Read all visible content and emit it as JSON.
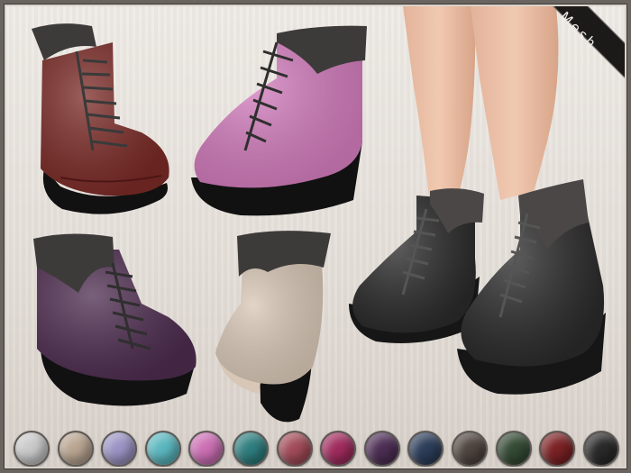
{
  "badge": {
    "label": "Mesh"
  },
  "boots": [
    {
      "name": "red-boot",
      "color": "#7a2a26"
    },
    {
      "name": "pink-boot",
      "color": "#d27cbc"
    },
    {
      "name": "purple-boot",
      "color": "#4d2c4f"
    },
    {
      "name": "beige-boot",
      "color": "#d8c7b6"
    },
    {
      "name": "black-boot",
      "color": "#2b2a2a"
    }
  ],
  "swatches": [
    {
      "name": "silver",
      "color": "#c9c9c9"
    },
    {
      "name": "beige",
      "color": "#b9a591"
    },
    {
      "name": "lavender",
      "color": "#9c94c4"
    },
    {
      "name": "turquoise",
      "color": "#5bb7bf"
    },
    {
      "name": "pink",
      "color": "#cc6fb4"
    },
    {
      "name": "teal",
      "color": "#2f7e7f"
    },
    {
      "name": "rose",
      "color": "#a24c58"
    },
    {
      "name": "magenta",
      "color": "#a02c5e"
    },
    {
      "name": "purple",
      "color": "#4e2f55"
    },
    {
      "name": "navy",
      "color": "#2d3e5a"
    },
    {
      "name": "brown",
      "color": "#4f4640"
    },
    {
      "name": "green",
      "color": "#354b35"
    },
    {
      "name": "red",
      "color": "#7c2225"
    },
    {
      "name": "black",
      "color": "#2a2a2a"
    }
  ]
}
